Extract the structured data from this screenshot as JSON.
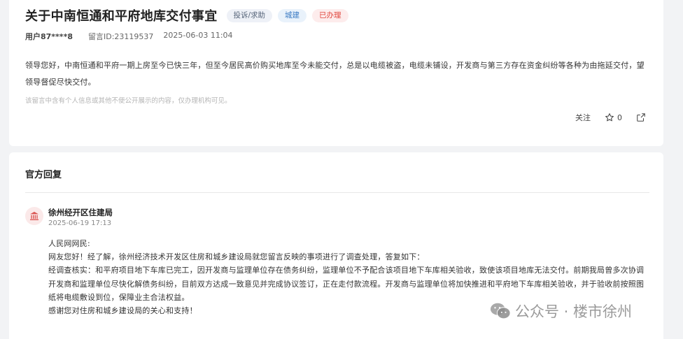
{
  "message": {
    "title": "关于中南恒通和平府地库交付事宜",
    "tags": {
      "category": "投诉/求助",
      "domain": "城建",
      "status": "已办理"
    },
    "user": "用户87****8",
    "message_id": "留言ID:23119537",
    "time": "2025-06-03 11:04",
    "body": "领导您好，中南恒通和平府一期上房至今已快三年，但至今居民高价购买地库至今未能交付，总是以电缆被盗，电缆未铺设，开发商与第三方存在资金纠纷等各种为由拖延交付，望领导督促尽快交付。",
    "privacy_note": "该留言中含有个人信息或其他不便公开展示的内容，仅办理机构可见。",
    "actions": {
      "follow_label": "关注",
      "like_count": "0"
    }
  },
  "reply": {
    "heading": "官方回复",
    "department": "徐州经开区住建局",
    "time": "2025-06-19 17:13",
    "paragraphs": [
      "人民网网民:",
      "网友您好！经了解，徐州经济技术开发区住房和城乡建设局就您留言反映的事项进行了调查处理，答复如下：",
      "经调查核实：和平府项目地下车库已完工，因开发商与监理单位存在债务纠纷，监理单位不予配合该项目地下车库相关验收，致使该项目地库无法交付。前期我局曾多次协调开发商和监理单位尽快化解债务纠纷，目前双方达成一致意见并完成协议签订，正在走付款流程。开发商与监理单位将加快推进和平府地下车库相关验收，并于验收前按照图纸将电缆敷设到位，保障业主合法权益。",
      "感谢您对住房和城乡建设局的关心和支持！"
    ]
  },
  "watermark": {
    "text": "公众号 · 楼市徐州"
  },
  "colors": {
    "status_red": "#e0473e",
    "domain_blue": "#3d7cc4",
    "page_bg": "#f2f3f5"
  },
  "icons": {
    "like": "star-icon",
    "share": "share-icon",
    "department": "government-building-icon",
    "watermark": "wechat-icon"
  }
}
